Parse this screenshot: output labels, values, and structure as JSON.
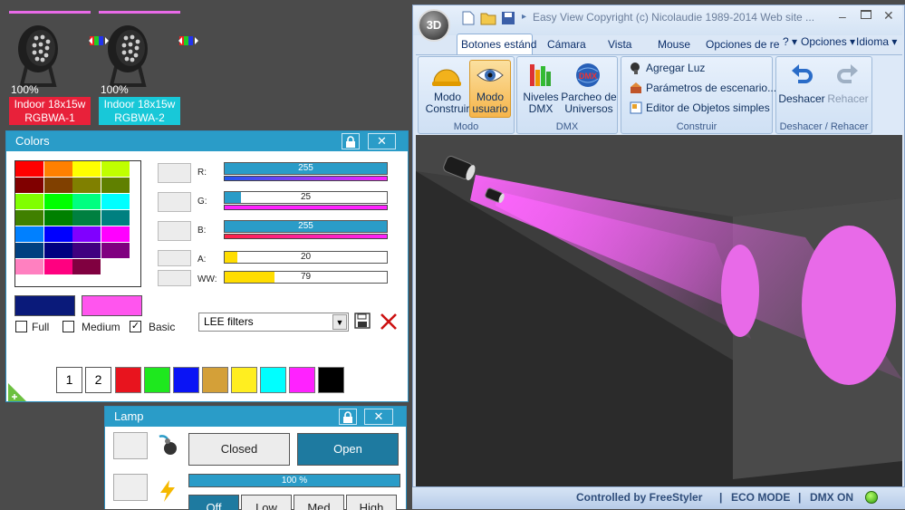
{
  "fixtures": [
    {
      "percent": "100%",
      "label_line1": "Indoor 18x15w",
      "label_line2": "RGBWA-1",
      "label_color": "#e8213a"
    },
    {
      "percent": "100%",
      "label_line1": "Indoor 18x15w",
      "label_line2": "RGBWA-2",
      "label_color": "#18c8d8"
    }
  ],
  "colors_window": {
    "title": "Colors",
    "lock_icon": "lock-icon",
    "close_label": "✕",
    "palette": [
      [
        "#ff0000",
        "#ff8000",
        "#ffff00",
        "#c0ff00"
      ],
      [
        "#800000",
        "#804000",
        "#808000",
        "#608000"
      ],
      [
        "#80ff00",
        "#00ff00",
        "#00ff80",
        "#00ffff"
      ],
      [
        "#408000",
        "#008000",
        "#008040",
        "#008080"
      ],
      [
        "#0080ff",
        "#0000ff",
        "#8000ff",
        "#ff00ff"
      ],
      [
        "#004080",
        "#000080",
        "#400080",
        "#800080"
      ],
      [
        "#ff80c0",
        "#ff0080",
        "#800040",
        "#ffffff"
      ]
    ],
    "sliders": [
      {
        "label": "R:",
        "value": "255",
        "fill": 1.0,
        "fill_color": "#2a9cc8",
        "line_color": "linear-gradient(90deg,#2255ee,#ff22ff)"
      },
      {
        "label": "G:",
        "value": "25",
        "fill": 0.1,
        "fill_color": "#2a9cc8",
        "line_color": "linear-gradient(90deg,#ff22ff,#ff22ff)"
      },
      {
        "label": "B:",
        "value": "255",
        "fill": 1.0,
        "fill_color": "#2a9cc8",
        "line_color": "linear-gradient(90deg,#ff2244,#ff22ff)"
      },
      {
        "label": "A:",
        "value": "20",
        "fill": 0.08,
        "fill_color": "#ffdd00",
        "line_color": ""
      },
      {
        "label": "WW:",
        "value": "79",
        "fill": 0.31,
        "fill_color": "#ffdd00",
        "line_color": ""
      }
    ],
    "current_color_a": "#0a1a7a",
    "current_color_b": "#ff55ee",
    "checkboxes": [
      {
        "label": "Full",
        "checked": false
      },
      {
        "label": "Medium",
        "checked": false
      },
      {
        "label": "Basic",
        "checked": true
      }
    ],
    "filter_select": "LEE filters",
    "quick_numbers": [
      "1",
      "2"
    ],
    "quick_colors": [
      "#e8141e",
      "#1ee81e",
      "#0a14f5",
      "#d4a038",
      "#ffee20",
      "#00ffff",
      "#ff22ff",
      "#000000"
    ]
  },
  "lamp_window": {
    "title": "Lamp",
    "closed_label": "Closed",
    "open_label": "Open",
    "progress_label": "100 %",
    "progress_value": 1.0,
    "mode_buttons": [
      "Off",
      "Low",
      "Med",
      "High"
    ]
  },
  "view3d": {
    "title_text": "Easy View   Copyright (c) Nicolaudie 1989-2014   Web site ...",
    "logo_text": "3D",
    "tabs": [
      "Botones estánd",
      "Cámara",
      "Vista",
      "Mouse",
      "Opciones de re"
    ],
    "right_tabs": [
      "?",
      "Opciones",
      "Idioma"
    ],
    "groups": {
      "modo": {
        "label": "Modo",
        "construir": "Modo\nConstruir",
        "usuario": "Modo\nusuario"
      },
      "dmx": {
        "label": "DMX",
        "niveles": "Niveles\nDMX",
        "parcheo": "Parcheo de\nUniversos",
        "dmx_badge": "DMX"
      },
      "construir": {
        "label": "Construir",
        "items": [
          "Agregar Luz",
          "Parámetros de escenario...",
          "Editor de Objetos simples"
        ]
      },
      "deshacer": {
        "label": "Deshacer / Rehacer",
        "undo": "Deshacer",
        "redo": "Rehacer"
      }
    },
    "status": {
      "controlled": "Controlled by FreeStyler",
      "eco": "ECO MODE",
      "dmx": "DMX ON",
      "sep": "|"
    }
  }
}
